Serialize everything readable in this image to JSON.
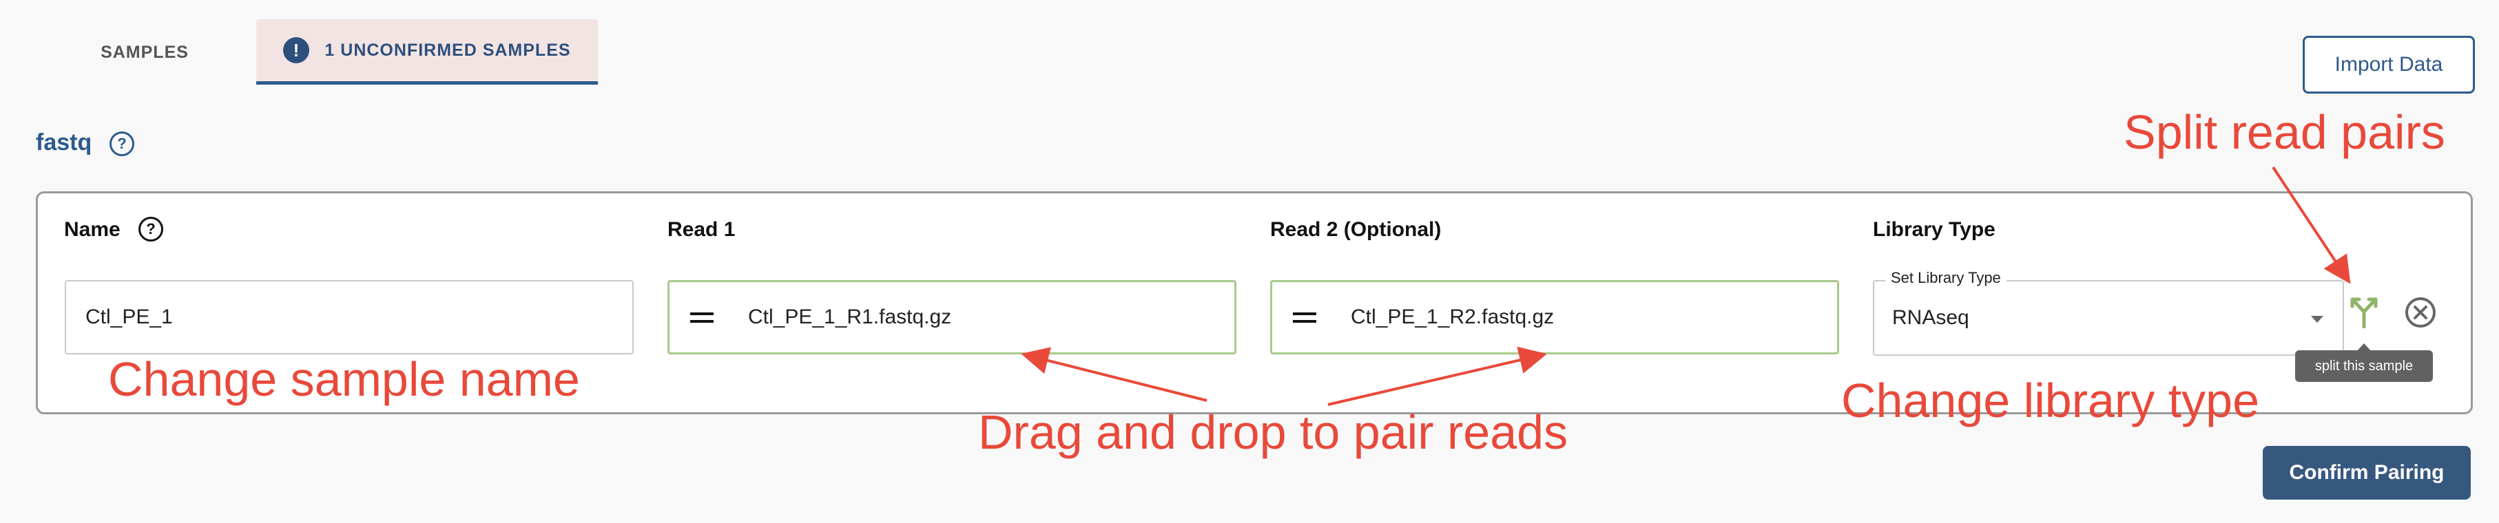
{
  "tabs": [
    {
      "label": "SAMPLES",
      "active": false
    },
    {
      "label": "1 UNCONFIRMED SAMPLES",
      "active": true,
      "badge": "!"
    }
  ],
  "import_button": "Import Data",
  "section": {
    "title": "fastq",
    "help_icon": "help-circle-icon"
  },
  "columns": {
    "name": "Name",
    "read1": "Read 1",
    "read2": "Read 2 (Optional)",
    "library": "Library Type"
  },
  "row": {
    "name_value": "Ctl_PE_1",
    "read1_value": "Ctl_PE_1_R1.fastq.gz",
    "read2_value": "Ctl_PE_1_R2.fastq.gz",
    "library_legend": "Set Library Type",
    "library_value": "RNAseq"
  },
  "icons": {
    "drag": "drag-handle-icon",
    "split": "split-icon",
    "remove": "close-circle-icon"
  },
  "tooltip": "split this sample",
  "confirm_button": "Confirm Pairing",
  "annotations": {
    "split": "Split read pairs",
    "name": "Change sample name",
    "drag": "Drag and drop to pair reads",
    "library": "Change library type"
  },
  "colors": {
    "accent": "#2d5a8c",
    "annotation": "#e8493a",
    "split_icon": "#8fb36a",
    "field_border": "#a8c98a"
  }
}
